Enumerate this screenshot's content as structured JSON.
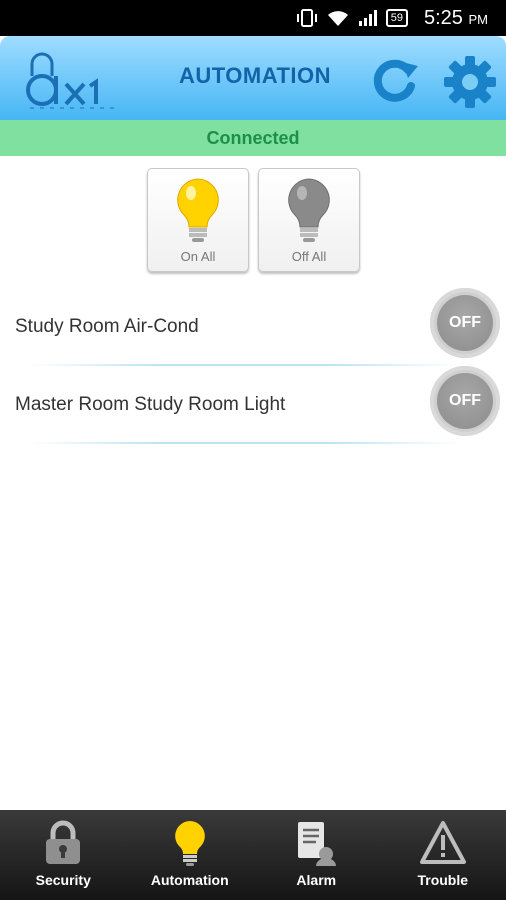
{
  "status_bar": {
    "time": "5:25",
    "ampm": "PM",
    "battery": "59"
  },
  "header": {
    "title": "AUTOMATION",
    "logo_text": "ax1"
  },
  "connection": {
    "status": "Connected"
  },
  "controls": {
    "on_all": "On All",
    "off_all": "Off All"
  },
  "devices": [
    {
      "name": "Study Room Air-Cond",
      "state": "OFF"
    },
    {
      "name": "Master Room Study Room Light",
      "state": "OFF"
    }
  ],
  "nav": {
    "items": [
      {
        "label": "Security",
        "icon": "padlock-icon"
      },
      {
        "label": "Automation",
        "icon": "lightbulb-icon"
      },
      {
        "label": "Alarm",
        "icon": "alarm-log-icon"
      },
      {
        "label": "Trouble",
        "icon": "warning-icon"
      }
    ]
  },
  "colors": {
    "header_gradient": [
      "#9fdcff",
      "#46b6f4"
    ],
    "title": "#1463a8",
    "connected_bg": "#7fe0a0",
    "connected_text": "#1e8f4a",
    "bulb_on": "#ffd700",
    "bulb_off": "#8a8a8a"
  }
}
